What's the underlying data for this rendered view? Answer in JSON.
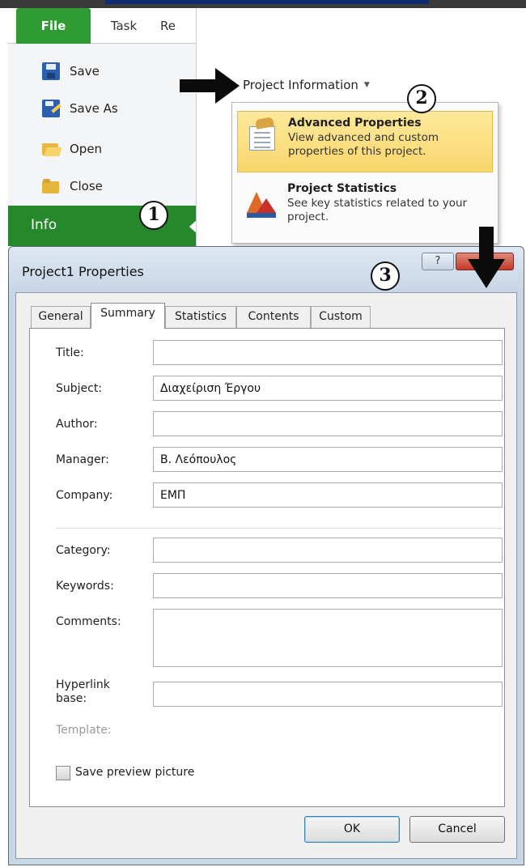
{
  "ribbon": {
    "tabs": [
      "File",
      "Task",
      "Re"
    ]
  },
  "backstage": {
    "items": [
      {
        "label": "Save",
        "icon": "save-icon"
      },
      {
        "label": "Save As",
        "icon": "save-as-icon"
      },
      {
        "label": "Open",
        "icon": "open-folder-icon"
      },
      {
        "label": "Close",
        "icon": "close-folder-icon"
      }
    ],
    "info_label": "Info",
    "accent_color": "#25882a"
  },
  "project_info": {
    "button_label": "Project Information",
    "menu": [
      {
        "title": "Advanced Properties",
        "description": "View advanced and custom properties of this project.",
        "icon": "advanced-properties-icon"
      },
      {
        "title": "Project Statistics",
        "description": "See key statistics related to your project.",
        "icon": "project-statistics-icon"
      }
    ]
  },
  "annotations": [
    "1",
    "2",
    "3"
  ],
  "dialog": {
    "title": "Project1 Properties",
    "help_label": "?",
    "tabs": [
      "General",
      "Summary",
      "Statistics",
      "Contents",
      "Custom"
    ],
    "active_tab": "Summary",
    "fields": {
      "title": {
        "label": "Title:",
        "value": ""
      },
      "subject": {
        "label": "Subject:",
        "value": "Διαχείριση Έργου"
      },
      "author": {
        "label": "Author:",
        "value": ""
      },
      "manager": {
        "label": "Manager:",
        "value": "Β. Λεόπουλος"
      },
      "company": {
        "label": "Company:",
        "value": "ΕΜΠ"
      },
      "category": {
        "label": "Category:",
        "value": ""
      },
      "keywords": {
        "label": "Keywords:",
        "value": ""
      },
      "comments": {
        "label": "Comments:",
        "value": ""
      },
      "hyperlink_base": {
        "label": "Hyperlink base:",
        "value": ""
      },
      "template": {
        "label": "Template:"
      }
    },
    "save_preview_label": "Save preview picture",
    "save_preview_checked": false,
    "ok_label": "OK",
    "cancel_label": "Cancel"
  }
}
